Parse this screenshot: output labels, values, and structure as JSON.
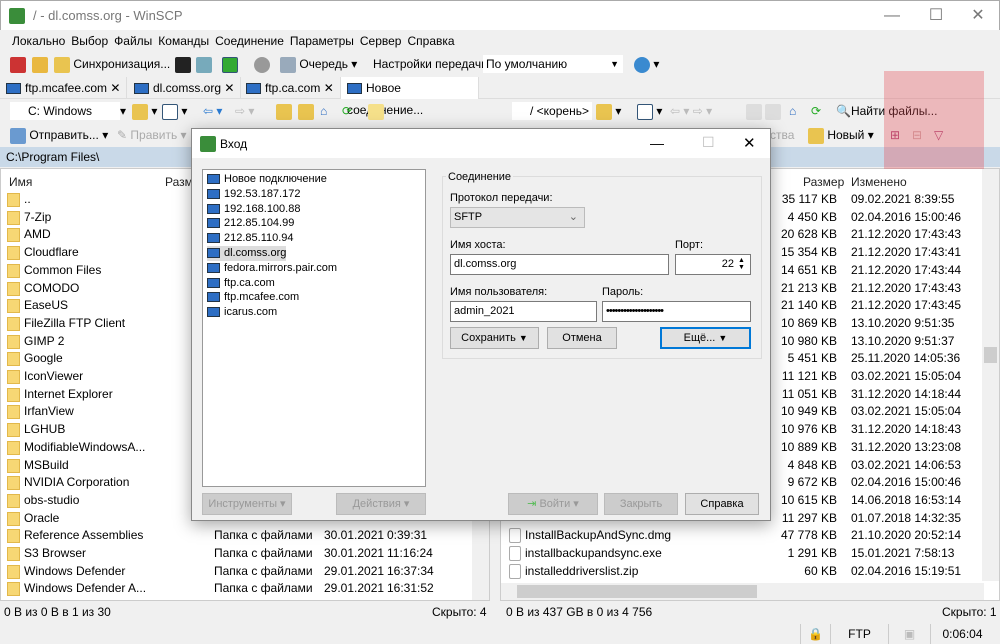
{
  "window": {
    "title": "/ - dl.comss.org - WinSCP",
    "minimize": "—",
    "maximize": "☐",
    "close": "✕"
  },
  "menu": [
    "Локально",
    "Выбор",
    "Файлы",
    "Команды",
    "Соединение",
    "Параметры",
    "Сервер",
    "Справка"
  ],
  "toolbar": {
    "sync_label": "Синхронизация...",
    "queue_label": "Очередь",
    "transfer_settings_label": "Настройки передачи",
    "transfer_preset": "По умолчанию"
  },
  "tabs": [
    {
      "label": "ftp.mcafee.com"
    },
    {
      "label": "dl.comss.org"
    },
    {
      "label": "ftp.ca.com"
    },
    {
      "label": "Новое соединение...",
      "active": true
    }
  ],
  "local": {
    "drive": "C: Windows",
    "send_label": "Отправить...",
    "edit_label": "Править",
    "path": "C:\\Program Files\\",
    "columns": {
      "name": "Имя",
      "size": "Разм"
    },
    "rows": [
      {
        "name": ".."
      },
      {
        "name": "7-Zip"
      },
      {
        "name": "AMD"
      },
      {
        "name": "Cloudflare"
      },
      {
        "name": "Common Files"
      },
      {
        "name": "COMODO"
      },
      {
        "name": "EaseUS"
      },
      {
        "name": "FileZilla FTP Client"
      },
      {
        "name": "GIMP 2"
      },
      {
        "name": "Google"
      },
      {
        "name": "IconViewer"
      },
      {
        "name": "Internet Explorer"
      },
      {
        "name": "IrfanView"
      },
      {
        "name": "LGHUB"
      },
      {
        "name": "ModifiableWindowsA..."
      },
      {
        "name": "MSBuild"
      },
      {
        "name": "NVIDIA Corporation"
      },
      {
        "name": "obs-studio"
      },
      {
        "name": "Oracle"
      },
      {
        "name": "Reference Assemblies",
        "type": "Папка с файлами",
        "date": "30.01.2021",
        "time": "0:39:31"
      },
      {
        "name": "S3 Browser",
        "type": "Папка с файлами",
        "date": "30.01.2021",
        "time": "11:16:24"
      },
      {
        "name": "Windows Defender",
        "type": "Папка с файлами",
        "date": "29.01.2021",
        "time": "16:37:34"
      },
      {
        "name": "Windows Defender A...",
        "type": "Папка с файлами",
        "date": "29.01.2021",
        "time": "16:31:52"
      }
    ],
    "status": "0 B из 0 B в 1 из 30",
    "hidden": "Скрыто: 4"
  },
  "remote": {
    "path": "/ <корень>",
    "find_label": "Найти файлы...",
    "props_label": "ства",
    "new_label": "Новый",
    "columns": {
      "size": "Размер",
      "modified": "Изменено"
    },
    "rows": [
      {
        "size": "35 117 KB",
        "modified": "09.02.2021 8:39:55"
      },
      {
        "size": "4 450 KB",
        "modified": "02.04.2016 15:00:46"
      },
      {
        "size": "20 628 KB",
        "modified": "21.12.2020 17:43:43"
      },
      {
        "size": "15 354 KB",
        "modified": "21.12.2020 17:43:41"
      },
      {
        "size": "14 651 KB",
        "modified": "21.12.2020 17:43:44"
      },
      {
        "size": "21 213 KB",
        "modified": "21.12.2020 17:43:43"
      },
      {
        "size": "21 140 KB",
        "modified": "21.12.2020 17:43:45"
      },
      {
        "size": "10 869 KB",
        "modified": "13.10.2020 9:51:35"
      },
      {
        "size": "10 980 KB",
        "modified": "13.10.2020 9:51:37"
      },
      {
        "size": "5 451 KB",
        "modified": "25.11.2020 14:05:36"
      },
      {
        "size": "11 121 KB",
        "modified": "03.02.2021 15:05:04"
      },
      {
        "size": "11 051 KB",
        "modified": "31.12.2020 14:18:44"
      },
      {
        "size": "10 949 KB",
        "modified": "03.02.2021 15:05:04"
      },
      {
        "size": "10 976 KB",
        "modified": "31.12.2020 14:18:43"
      },
      {
        "size": "10 889 KB",
        "modified": "31.12.2020 13:23:08"
      },
      {
        "size": "4 848 KB",
        "modified": "03.02.2021 14:06:53"
      },
      {
        "size": "9 672 KB",
        "modified": "02.04.2016 15:00:46"
      },
      {
        "size": "10 615 KB",
        "modified": "14.06.2018 16:53:14"
      },
      {
        "size": "11 297 KB",
        "modified": "01.07.2018 14:32:35"
      },
      {
        "name": "InstallBackupAndSync.dmg",
        "size": "47 778 KB",
        "modified": "21.10.2020 20:52:14"
      },
      {
        "name": "installbackupandsync.exe",
        "size": "1 291 KB",
        "modified": "15.01.2021 7:58:13"
      },
      {
        "name": "installeddriverslist.zip",
        "size": "60 KB",
        "modified": "02.04.2016 15:19:51"
      }
    ],
    "status": "0 B из 437 GB в 0 из 4 756",
    "hidden": "Скрыто: 1"
  },
  "statusbar": {
    "protocol": "FTP",
    "elapsed": "0:06:04"
  },
  "dialog": {
    "title": "Вход",
    "sites": [
      {
        "label": "Новое подключение",
        "new": true
      },
      {
        "label": "192.53.187.172"
      },
      {
        "label": "192.168.100.88"
      },
      {
        "label": "212.85.104.99"
      },
      {
        "label": "212.85.110.94"
      },
      {
        "label": "dl.comss.org",
        "selected": true
      },
      {
        "label": "fedora.mirrors.pair.com"
      },
      {
        "label": "ftp.ca.com"
      },
      {
        "label": "ftp.mcafee.com"
      },
      {
        "label": "icarus.com"
      }
    ],
    "group_label": "Соединение",
    "protocol_label": "Протокол передачи:",
    "protocol": "SFTP",
    "host_label": "Имя хоста:",
    "host": "dl.comss.org",
    "port_label": "Порт:",
    "port": "22",
    "user_label": "Имя пользователя:",
    "user": "admin_2021",
    "password_label": "Пароль:",
    "password": "••••••••••••••••••••",
    "save": "Сохранить",
    "cancel": "Отмена",
    "more": "Ещё...",
    "tools": "Инструменты",
    "actions": "Действия",
    "login": "Войти",
    "close": "Закрыть",
    "help": "Справка"
  }
}
